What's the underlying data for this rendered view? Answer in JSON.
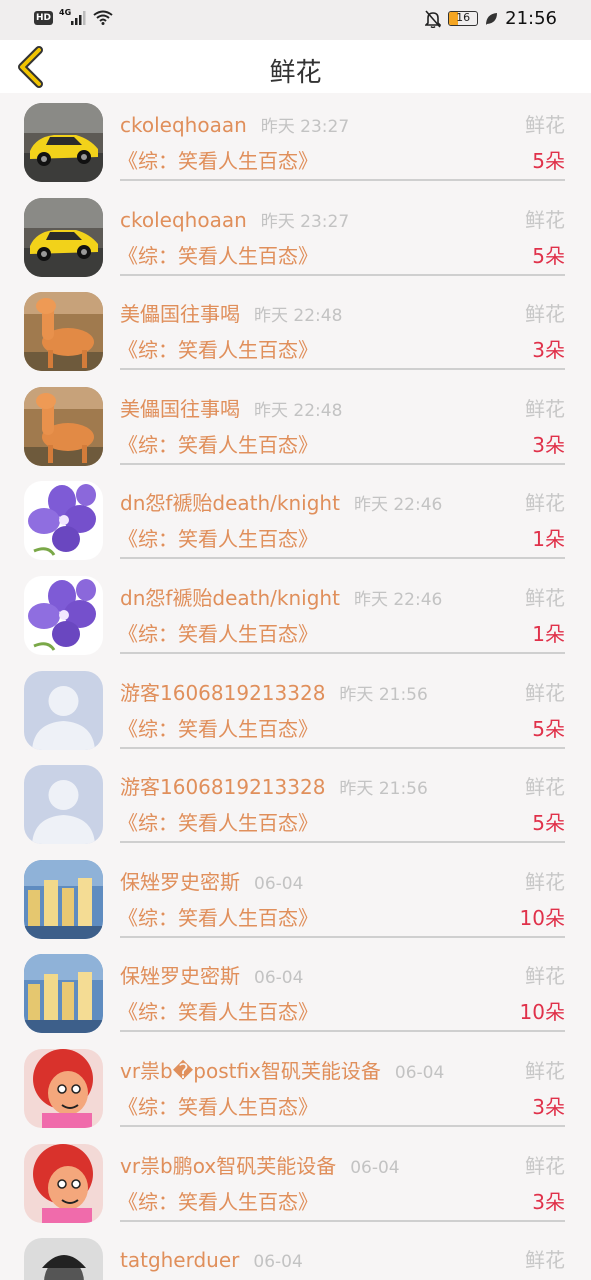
{
  "status_bar": {
    "hd": "HD",
    "network": "4G",
    "battery": "16",
    "time": "21:56"
  },
  "header": {
    "title": "鲜花"
  },
  "rows": [
    {
      "name": "ckoleqhoaan",
      "time": "昨天 23:27",
      "type": "鲜花",
      "book": "《综：笑看人生百态》",
      "count": "5朵",
      "avatar": "car"
    },
    {
      "name": "ckoleqhoaan",
      "time": "昨天 23:27",
      "type": "鲜花",
      "book": "《综：笑看人生百态》",
      "count": "5朵",
      "avatar": "car"
    },
    {
      "name": "美儡国往事喝",
      "time": "昨天 22:48",
      "type": "鲜花",
      "book": "《综：笑看人生百态》",
      "count": "3朵",
      "avatar": "alpaca"
    },
    {
      "name": "美儡国往事喝",
      "time": "昨天 22:48",
      "type": "鲜花",
      "book": "《综：笑看人生百态》",
      "count": "3朵",
      "avatar": "alpaca"
    },
    {
      "name": "dn怨f褫贻death/knight",
      "time": "昨天 22:46",
      "type": "鲜花",
      "book": "《综：笑看人生百态》",
      "count": "1朵",
      "avatar": "flower"
    },
    {
      "name": "dn怨f褫贻death/knight",
      "time": "昨天 22:46",
      "type": "鲜花",
      "book": "《综：笑看人生百态》",
      "count": "1朵",
      "avatar": "flower"
    },
    {
      "name": "游客1606819213328",
      "time": "昨天 21:56",
      "type": "鲜花",
      "book": "《综：笑看人生百态》",
      "count": "5朵",
      "avatar": "default"
    },
    {
      "name": "游客1606819213328",
      "time": "昨天 21:56",
      "type": "鲜花",
      "book": "《综：笑看人生百态》",
      "count": "5朵",
      "avatar": "default"
    },
    {
      "name": "保矬罗史密斯",
      "time": "06-04",
      "type": "鲜花",
      "book": "《综：笑看人生百态》",
      "count": "10朵",
      "avatar": "city"
    },
    {
      "name": "保矬罗史密斯",
      "time": "06-04",
      "type": "鲜花",
      "book": "《综：笑看人生百态》",
      "count": "10朵",
      "avatar": "city"
    },
    {
      "name": "vr祟b�postfix智矾芙能设备",
      "time": "06-04",
      "type": "鲜花",
      "book": "《综：笑看人生百态》",
      "count": "3朵",
      "avatar": "cartoon"
    },
    {
      "name": "vr祟b鹏ox智矾芙能设备",
      "time": "06-04",
      "type": "鲜花",
      "book": "《综：笑看人生百态》",
      "count": "3朵",
      "avatar": "cartoon"
    },
    {
      "name": "tatgherduer",
      "time": "06-04",
      "type": "鲜花",
      "book": "",
      "count": "",
      "avatar": "person"
    }
  ],
  "colors": {
    "name": "#e08f5b",
    "count": "#e0314a",
    "muted": "#c3c3c3",
    "back_arrow": "#f0c300"
  },
  "icons": {
    "back": "chevron-left-icon",
    "mute": "bell-off-icon",
    "wifi": "wifi-icon",
    "leaf": "leaf-icon"
  }
}
